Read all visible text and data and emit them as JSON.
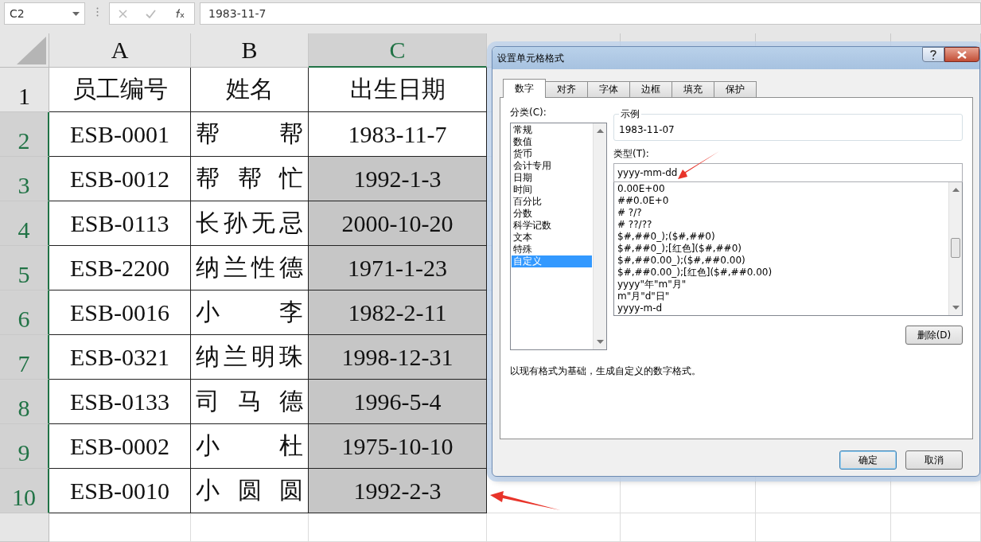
{
  "formula_bar": {
    "name_box": "C2",
    "formula": "1983-11-7"
  },
  "columns": [
    {
      "label": "A",
      "selected": false
    },
    {
      "label": "B",
      "selected": false
    },
    {
      "label": "C",
      "selected": true
    }
  ],
  "rows": [
    {
      "header": "1",
      "selected": false,
      "cells": [
        {
          "text": "员工编号",
          "selected": false
        },
        {
          "text": "姓名",
          "selected": false
        },
        {
          "text": "出生日期",
          "selected": false
        }
      ]
    },
    {
      "header": "2",
      "selected": true,
      "cells": [
        {
          "text": "ESB-0001",
          "selected": false
        },
        {
          "text": "帮帮",
          "selected": false
        },
        {
          "text": "1983-11-7",
          "selected": false
        }
      ]
    },
    {
      "header": "3",
      "selected": true,
      "cells": [
        {
          "text": "ESB-0012",
          "selected": false
        },
        {
          "text": "帮帮忙",
          "selected": false
        },
        {
          "text": "1992-1-3",
          "selected": true
        }
      ]
    },
    {
      "header": "4",
      "selected": true,
      "cells": [
        {
          "text": "ESB-0113",
          "selected": false
        },
        {
          "text": "长孙无忌",
          "selected": false
        },
        {
          "text": "2000-10-20",
          "selected": true
        }
      ]
    },
    {
      "header": "5",
      "selected": true,
      "cells": [
        {
          "text": "ESB-2200",
          "selected": false
        },
        {
          "text": "纳兰性德",
          "selected": false
        },
        {
          "text": "1971-1-23",
          "selected": true
        }
      ]
    },
    {
      "header": "6",
      "selected": true,
      "cells": [
        {
          "text": "ESB-0016",
          "selected": false
        },
        {
          "text": "小李",
          "selected": false
        },
        {
          "text": "1982-2-11",
          "selected": true
        }
      ]
    },
    {
      "header": "7",
      "selected": true,
      "cells": [
        {
          "text": "ESB-0321",
          "selected": false
        },
        {
          "text": "纳兰明珠",
          "selected": false
        },
        {
          "text": "1998-12-31",
          "selected": true
        }
      ]
    },
    {
      "header": "8",
      "selected": true,
      "cells": [
        {
          "text": "ESB-0133",
          "selected": false
        },
        {
          "text": "司马德",
          "selected": false
        },
        {
          "text": "1996-5-4",
          "selected": true
        }
      ]
    },
    {
      "header": "9",
      "selected": true,
      "cells": [
        {
          "text": "ESB-0002",
          "selected": false
        },
        {
          "text": "小杜",
          "selected": false
        },
        {
          "text": "1975-10-10",
          "selected": true
        }
      ]
    },
    {
      "header": "10",
      "selected": true,
      "cells": [
        {
          "text": "ESB-0010",
          "selected": false
        },
        {
          "text": "小圆圆",
          "selected": false
        },
        {
          "text": "1992-2-3",
          "selected": true
        }
      ]
    }
  ],
  "dialog": {
    "title": "设置单元格格式",
    "tabs": [
      {
        "label": "数字",
        "selected": true
      },
      {
        "label": "对齐",
        "selected": false
      },
      {
        "label": "字体",
        "selected": false
      },
      {
        "label": "边框",
        "selected": false
      },
      {
        "label": "填充",
        "selected": false
      },
      {
        "label": "保护",
        "selected": false
      }
    ],
    "category_label": "分类(C):",
    "categories": [
      {
        "label": "常规",
        "selected": false
      },
      {
        "label": "数值",
        "selected": false
      },
      {
        "label": "货币",
        "selected": false
      },
      {
        "label": "会计专用",
        "selected": false
      },
      {
        "label": "日期",
        "selected": false
      },
      {
        "label": "时间",
        "selected": false
      },
      {
        "label": "百分比",
        "selected": false
      },
      {
        "label": "分数",
        "selected": false
      },
      {
        "label": "科学记数",
        "selected": false
      },
      {
        "label": "文本",
        "selected": false
      },
      {
        "label": "特殊",
        "selected": false
      },
      {
        "label": "自定义",
        "selected": true
      }
    ],
    "sample_label": "示例",
    "sample": "1983-11-07",
    "type_label": "类型(T):",
    "type_value": "yyyy-mm-dd",
    "formats": [
      "0.00E+00",
      "##0.0E+0",
      "# ?/?",
      "# ??/??",
      "$#,##0_);($#,##0)",
      "$#,##0_);[红色]($#,##0)",
      "$#,##0.00_);($#,##0.00)",
      "$#,##0.00_);[红色]($#,##0.00)",
      "yyyy\"年\"m\"月\"",
      "m\"月\"d\"日\"",
      "yyyy-m-d"
    ],
    "delete_button": "删除(D)",
    "description": "以现有格式为基础，生成自定义的数字格式。",
    "buttons": [
      "确定",
      "取消"
    ]
  }
}
